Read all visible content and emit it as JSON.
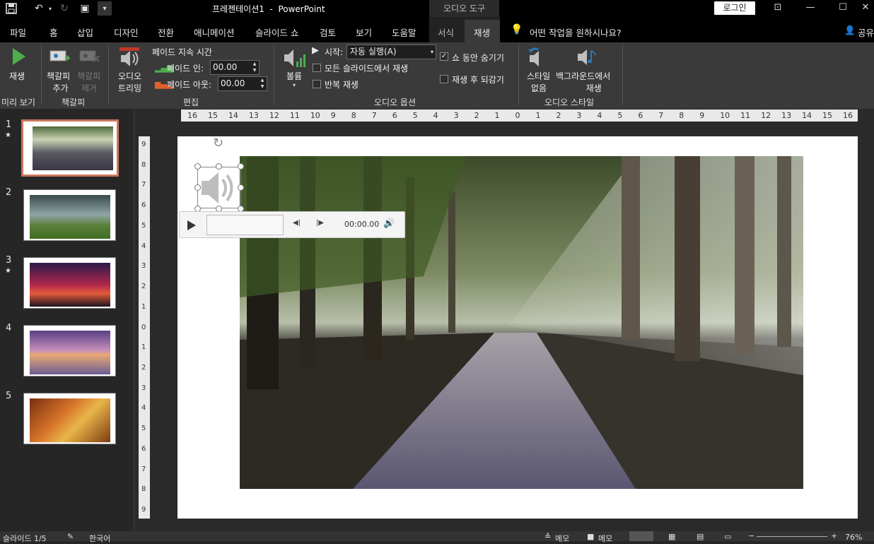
{
  "titlebar": {
    "title": "프레젠테이션1  -  PowerPoint",
    "context_group": "오디오 도구",
    "login": "로그인",
    "customize_qat": "▾"
  },
  "tabs": [
    "파일",
    "홈",
    "삽입",
    "디자인",
    "전환",
    "애니메이션",
    "슬라이드 쇼",
    "검토",
    "보기",
    "도움말",
    "서식",
    "재생"
  ],
  "tell_me": "어떤 작업을 원하시나요?",
  "share": "공유",
  "ribbon": {
    "play": "재생",
    "add_bookmark": [
      "책갈피",
      "추가"
    ],
    "remove_bookmark": [
      "책갈피",
      "제거"
    ],
    "trim_audio": [
      "오디오",
      "트리밍"
    ],
    "fade_duration": "페이드 지속 시간",
    "fade_in_label": "페이드 인:",
    "fade_in_value": "00.00",
    "fade_out_label": "페이드 아웃:",
    "fade_out_value": "00.00",
    "volume": "볼륨",
    "start_label": "시작:",
    "start_value": "자동 실행(A)",
    "play_across_slides": "모든 슬라이드에서 재생",
    "loop": "반복 재생",
    "hide_during_show": "쇼 동안 숨기기",
    "rewind_after": "재생 후 되감기",
    "no_style": [
      "스타일",
      "없음"
    ],
    "play_in_bg": [
      "백그라운드에서",
      "재생"
    ],
    "groups": {
      "preview": "미리 보기",
      "bookmarks": "책갈피",
      "editing": "편집",
      "audio_options": "오디오 옵션",
      "audio_styles": "오디오 스타일"
    }
  },
  "slides": [
    {
      "num": "1",
      "star": "★",
      "selected": true
    },
    {
      "num": "2",
      "star": ""
    },
    {
      "num": "3",
      "star": "★"
    },
    {
      "num": "4",
      "star": ""
    },
    {
      "num": "5",
      "star": ""
    }
  ],
  "ruler_h": [
    "16",
    "15",
    "14",
    "13",
    "12",
    "11",
    "10",
    "9",
    "8",
    "7",
    "6",
    "5",
    "4",
    "3",
    "2",
    "1",
    "0",
    "1",
    "2",
    "3",
    "4",
    "5",
    "6",
    "7",
    "8",
    "9",
    "10",
    "11",
    "12",
    "13",
    "14",
    "15",
    "16"
  ],
  "ruler_v": [
    "9",
    "8",
    "7",
    "6",
    "5",
    "4",
    "3",
    "2",
    "1",
    "0",
    "1",
    "2",
    "3",
    "4",
    "5",
    "6",
    "7",
    "8",
    "9"
  ],
  "player": {
    "time": "00:00.00"
  },
  "status": {
    "slide": "슬라이드 1/5",
    "language": "한국어",
    "notes": "메모",
    "comments": "메모",
    "zoom": "76%"
  }
}
